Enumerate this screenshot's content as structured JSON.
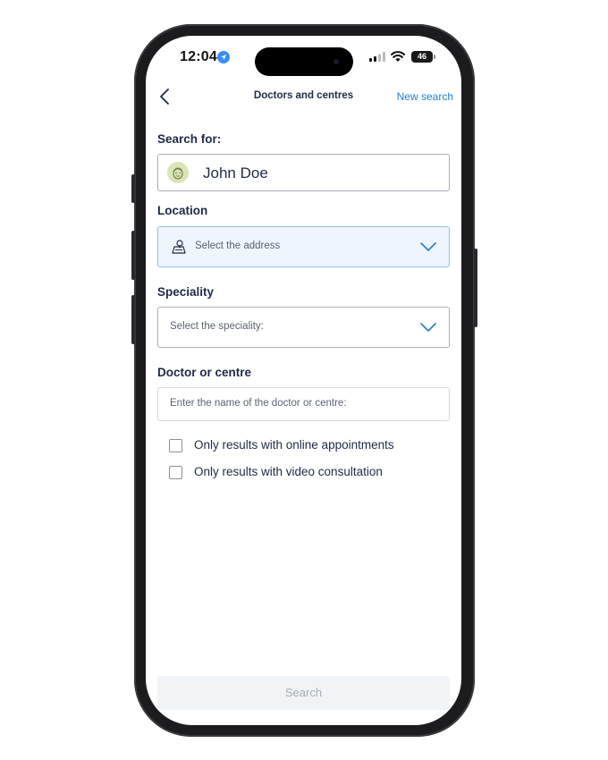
{
  "status_bar": {
    "time": "12:04",
    "battery": "46",
    "icons": [
      "location-icon",
      "signal-icon",
      "wifi-icon",
      "battery-icon"
    ]
  },
  "nav": {
    "back_icon": "chevron-left-icon",
    "title": "Doctors and centres",
    "action": "New search"
  },
  "form": {
    "search_for_label": "Search for:",
    "patient_name": "John Doe",
    "location_label": "Location",
    "location_placeholder": "Select the address",
    "speciality_label": "Speciality",
    "speciality_placeholder": "Select the speciality:",
    "doctor_label": "Doctor or centre",
    "doctor_placeholder": "Enter the name of the doctor or centre:",
    "options": [
      {
        "label": "Only results with online appointments",
        "checked": false
      },
      {
        "label": "Only results with video consultation",
        "checked": false
      }
    ],
    "search_button": "Search"
  },
  "colors": {
    "accent": "#1f7fd1",
    "text": "#1f2a44",
    "location_field_bg": "#eef5fc",
    "button_disabled_bg": "#f1f4f7"
  }
}
